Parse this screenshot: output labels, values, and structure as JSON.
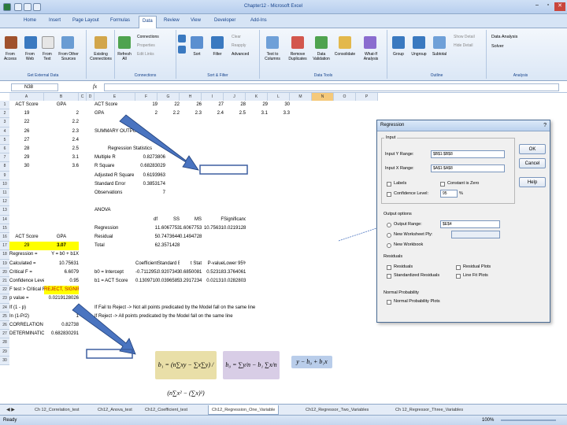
{
  "window": {
    "title": "Chapter12 - Microsoft Excel"
  },
  "tabs": [
    "Home",
    "Insert",
    "Page Layout",
    "Formulas",
    "Data",
    "Review",
    "View",
    "Developer",
    "Add-Ins"
  ],
  "ribbon": {
    "groups": [
      {
        "label": "Get External Data",
        "buttons": [
          "From Access",
          "From Web",
          "From Text",
          "From Other Sources"
        ]
      },
      {
        "label": "",
        "buttons": [
          "Existing Connections"
        ]
      },
      {
        "label": "Connections",
        "buttons": [
          "Refresh All"
        ],
        "small": [
          "Connections",
          "Properties",
          "Edit Links"
        ]
      },
      {
        "label": "Sort & Filter",
        "buttons": [
          "Sort",
          "Filter"
        ],
        "small": [
          "Clear",
          "Reapply",
          "Advanced"
        ]
      },
      {
        "label": "Data Tools",
        "buttons": [
          "Text to Columns",
          "Remove Duplicates",
          "Data Validation",
          "Consolidate",
          "What-If Analysis"
        ]
      },
      {
        "label": "Outline",
        "buttons": [
          "Group",
          "Ungroup",
          "Subtotal"
        ],
        "small": [
          "Show Detail",
          "Hide Detail"
        ]
      },
      {
        "label": "Analysis",
        "small": [
          "Data Analysis",
          "Solver"
        ]
      }
    ]
  },
  "formula_bar": {
    "name_box": "N38",
    "fx": "fx",
    "content": ""
  },
  "columns": [
    "A",
    "B",
    "C",
    "D",
    "E",
    "F",
    "G",
    "H",
    "I",
    "J",
    "K",
    "L",
    "M",
    "N",
    "O",
    "P"
  ],
  "rows": [
    "1",
    "2",
    "3",
    "4",
    "5",
    "6",
    "7",
    "8",
    "9",
    "10",
    "11",
    "12",
    "13",
    "14",
    "15",
    "16",
    "17",
    "18",
    "19",
    "20",
    "21",
    "22",
    "23",
    "24",
    "25",
    "26",
    "27",
    "28",
    "29",
    "30"
  ],
  "sheet": {
    "a1": "ACT Score",
    "b1": "GPA",
    "data": [
      [
        "19",
        "2"
      ],
      [
        "22",
        "2.2"
      ],
      [
        "26",
        "2.3"
      ],
      [
        "27",
        "2.4"
      ],
      [
        "28",
        "2.5"
      ],
      [
        "29",
        "3.1"
      ],
      [
        "30",
        "3.6"
      ]
    ],
    "e1": "ACT Score",
    "e2": "GPA",
    "e_row1": [
      "19",
      "22",
      "26",
      "27",
      "28",
      "29",
      "30"
    ],
    "e_row2": [
      "2",
      "2.2",
      "2.3",
      "2.4",
      "2.5",
      "3.1",
      "3.3"
    ],
    "summary_title": "SUMMARY OUTPUT",
    "reg_stats_title": "Regression Statistics",
    "reg_stats": [
      [
        "Multiple R",
        "0.8273806"
      ],
      [
        "R Square",
        "0.68283029"
      ],
      [
        "Adjusted R Square",
        "0.6193963"
      ],
      [
        "Standard Error",
        "0.3853174"
      ],
      [
        "Observations",
        "7"
      ]
    ],
    "anova_title": "ANOVA",
    "anova_hdr": [
      "df",
      "SS",
      "MS",
      "F",
      "Significance F"
    ],
    "anova": [
      [
        "Regression",
        "1",
        "1.606775300",
        "1.606775300",
        "10.75631",
        "0.021912803"
      ],
      [
        "Residual",
        "5",
        "0.747364465",
        "0.149472893",
        "",
        ""
      ],
      [
        "Total",
        "6",
        "2.357142857",
        "",
        "",
        ""
      ]
    ],
    "coef_hdr": [
      "Coefficients",
      "Standard Error",
      "t Stat",
      "P-value",
      "Lower 95%"
    ],
    "coef": [
      [
        "b0 = Intercept",
        "-0.7112952",
        "0.9207343",
        "0.685008182",
        "0.52318",
        "3.376406173"
      ],
      [
        "b1 = ACT Score",
        "0.13097108",
        "0.0396585",
        "3.291723413",
        "0.02131",
        "0.028280387"
      ]
    ],
    "a16": "ACT Score",
    "b16": "GPA",
    "a17": "29",
    "b17": "3.07",
    "left_block": [
      [
        "Regression =",
        "Y = b0 + b1X"
      ],
      [
        "Calculated =",
        "10.75631"
      ],
      [
        "Critical F =",
        "6.6079"
      ],
      [
        "Confidence Level =",
        "0.95"
      ],
      [
        "F test > Critical Reject",
        "REJECT, SIGNIFICANT"
      ],
      [
        "p value =",
        "0.0219128026"
      ],
      [
        "If (1 - p)",
        "1"
      ],
      [
        "In (1-P/2)",
        "1"
      ],
      [
        "CORRELATION (r) =",
        "0.82738"
      ],
      [
        "DETERMINATION (R²) =",
        "0.682830291"
      ]
    ],
    "note1": "If Fail to Reject -> Not all points predicated by the Model fall on the same line",
    "note2": "If Reject -> All points predicated by the Model fall on the same line"
  },
  "formulas": {
    "b1": "b₁ = (n∑xy − ∑x∑y) / (n∑x² − (∑x)²)",
    "b0": "b₀ = ∑y/n − b₁ ∑x/n",
    "model": "y − b₀ + b₁x"
  },
  "dialog": {
    "title": "Regression",
    "input_section": "Input",
    "input_y_label": "Input Y Range:",
    "input_y_value": "$B$1:$B$8",
    "input_x_label": "Input X Range:",
    "input_x_value": "$A$1:$A$8",
    "labels": "Labels",
    "constant_zero": "Constant is Zero",
    "confidence_label": "Confidence Level:",
    "confidence_value": "95",
    "pct": "%",
    "output_section": "Output options",
    "output_range": "Output Range:",
    "output_range_value": "$E$4",
    "new_ws": "New Worksheet Ply:",
    "new_wb": "New Workbook",
    "residuals_section": "Residuals",
    "residuals": "Residuals",
    "std_residuals": "Standardized Residuals",
    "residual_plots": "Residual Plots",
    "line_fit": "Line Fit Plots",
    "normal_section": "Normal Probability",
    "normal_plots": "Normal Probability Plots",
    "ok": "OK",
    "cancel": "Cancel",
    "help": "Help"
  },
  "sheet_tabs": [
    "Ch 12_Correlation_test",
    "Ch12_Anova_test",
    "Ch12_Coefficient_test",
    "Ch12_Regression_One_Variable",
    "Ch12_Regressor_Two_Variables",
    "Ch 12_Regressor_Three_Variables"
  ],
  "status": {
    "ready": "Ready",
    "zoom": "100%"
  }
}
